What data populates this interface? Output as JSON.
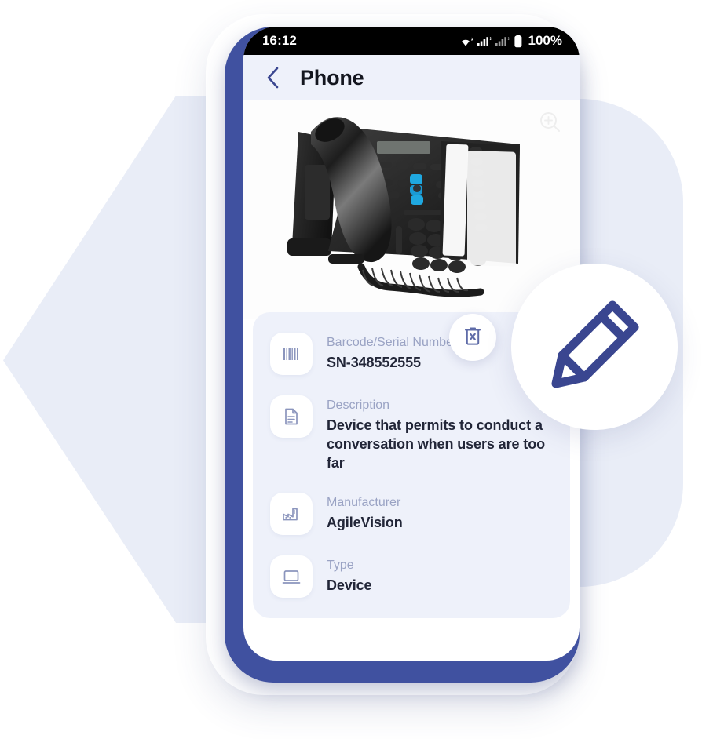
{
  "theme": {
    "accent": "#3a4690",
    "device_body": "#4051a0",
    "card_bg": "#eef1fa",
    "shape_bg": "#e9edf7",
    "label_color": "#9aa3c4",
    "value_color": "#222638"
  },
  "status_bar": {
    "time": "16:12",
    "battery_percent": "100%",
    "icons": [
      "wifi-icon",
      "cellular-signal-icon",
      "cellular-signal-2-icon",
      "battery-icon"
    ]
  },
  "header": {
    "back_icon": "chevron-left-icon",
    "title": "Phone"
  },
  "hero": {
    "image_alt": "black desk ip phone",
    "zoom_icon": "zoom-in-icon"
  },
  "actions": {
    "delete_icon": "trash-x-icon",
    "delete_label": "Delete",
    "edit_icon": "pencil-icon",
    "edit_label": "Edit"
  },
  "details": {
    "rows": [
      {
        "icon": "barcode-icon",
        "label": "Barcode/Serial Number",
        "value": "SN-348552555"
      },
      {
        "icon": "document-icon",
        "label": "Description",
        "value": "Device that permits to conduct a conversation when users are too far"
      },
      {
        "icon": "factory-icon",
        "label": "Manufacturer",
        "value": "AgileVision"
      },
      {
        "icon": "monitor-icon",
        "label": "Type",
        "value": "Device"
      }
    ]
  }
}
